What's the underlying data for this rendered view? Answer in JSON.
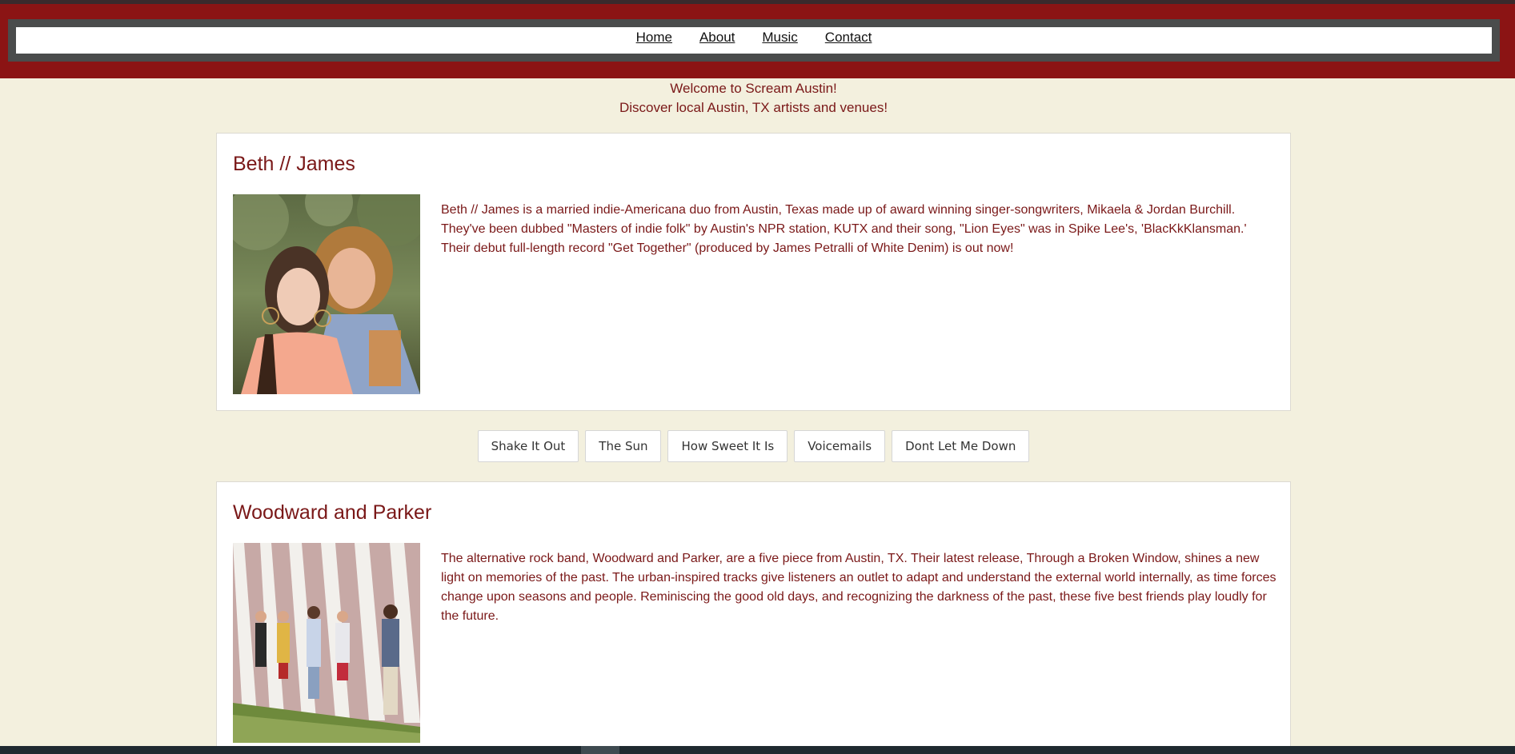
{
  "nav": {
    "links": [
      "Home",
      "About",
      "Music",
      "Contact"
    ]
  },
  "welcome": {
    "line1": "Welcome to Scream Austin!",
    "line2": "Discover local Austin, TX artists and venues!"
  },
  "artists": [
    {
      "name": "Beth // James",
      "description": "Beth // James is a married indie-Americana duo from Austin, Texas made up of award winning singer-songwriters, Mikaela & Jordan Burchill. They've been dubbed \"Masters of indie folk\" by Austin's NPR station, KUTX and their song, \"Lion Eyes\" was in Spike Lee's, 'BlacKkKlansman.' Their debut full-length record \"Get Together\" (produced by James Petralli of White Denim) is out now!"
    },
    {
      "name": "Woodward and Parker",
      "description": "The alternative rock band, Woodward and Parker, are a five piece from Austin, TX. Their latest release, Through a Broken Window, shines a new light on memories of the past. The urban-inspired tracks give listeners an outlet to adapt and understand the external world internally, as time forces change upon seasons and people. Reminiscing the good old days, and recognizing the darkness of the past, these five best friends play loudly for the future."
    }
  ],
  "songs": [
    "Shake It Out",
    "The Sun",
    "How Sweet It Is",
    "Voicemails",
    "Dont Let Me Down"
  ],
  "colors": {
    "header": "#8b1414",
    "nav_frame": "#4a4c4c",
    "background": "#f3f0de",
    "accent_text": "#7a1818"
  }
}
